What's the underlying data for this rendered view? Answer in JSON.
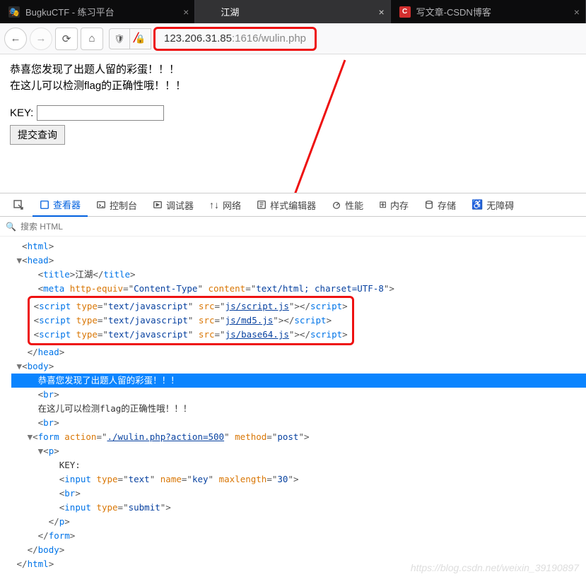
{
  "tabs": [
    {
      "label": "BugkuCTF - 练习平台",
      "close": "×"
    },
    {
      "label": "江湖",
      "close": "×"
    },
    {
      "label": "写文章-CSDN博客",
      "close": "×",
      "fav": "C"
    }
  ],
  "url": {
    "host": "123.206.31.85",
    "port": ":1616",
    "path": "/wulin.php"
  },
  "page": {
    "line1": "恭喜您发现了出题人留的彩蛋！！！",
    "line2": "在这儿可以检测flag的正确性哦！！！",
    "keylabel": "KEY:",
    "submit": "提交查询"
  },
  "devtabs": {
    "picker": "",
    "inspector": "查看器",
    "console": "控制台",
    "debugger": "调试器",
    "network": "网络",
    "styles": "样式编辑器",
    "perf": "性能",
    "memory": "内存",
    "storage": "存储",
    "a11y": "无障碍"
  },
  "search_placeholder": "搜索 HTML",
  "dom": {
    "title": "江湖",
    "meta_equiv": "Content-Type",
    "meta_content": "text/html; charset=UTF-8",
    "script_type": "text/javascript",
    "script1": "js/script.js",
    "script2": "js/md5.js",
    "script3": "js/base64.js",
    "body_text1": "恭喜您发现了出题人留的彩蛋！！！",
    "body_text2": "在这儿可以检测flag的正确性哦！！！",
    "form_action": "./wulin.php?action=500",
    "form_method": "post",
    "key_text": "KEY:",
    "input_type": "text",
    "input_name": "key",
    "input_maxlen": "30",
    "submit_type": "submit"
  },
  "watermark": "https://blog.csdn.net/weixin_39190897"
}
